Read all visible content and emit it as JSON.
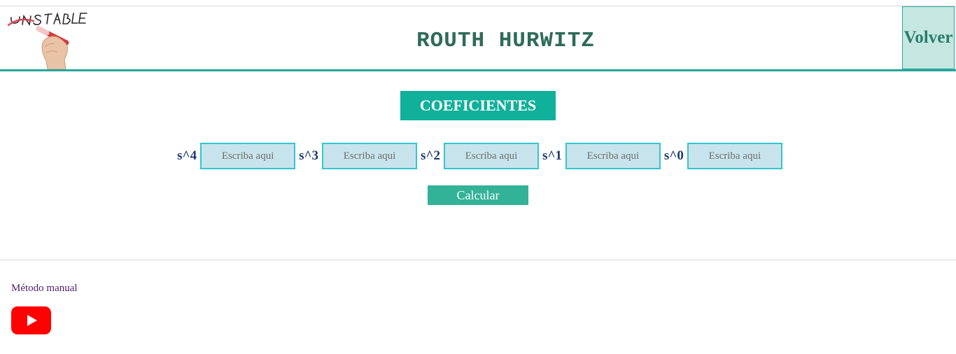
{
  "header": {
    "logo_text": "UNSTABLE",
    "title": "ROUTH HURWITZ",
    "back_label": "Volver"
  },
  "main": {
    "section_heading": "COEFICIENTES",
    "coefficients": [
      {
        "label": "s^4",
        "value": "",
        "placeholder": "Escriba aqui"
      },
      {
        "label": "s^3",
        "value": "",
        "placeholder": "Escriba aqui"
      },
      {
        "label": "s^2",
        "value": "",
        "placeholder": "Escriba aqui"
      },
      {
        "label": "s^1",
        "value": "",
        "placeholder": "Escriba aqui"
      },
      {
        "label": "s^0",
        "value": "",
        "placeholder": "Escriba aqui"
      }
    ],
    "calculate_label": "Calcular"
  },
  "footer": {
    "manual_link": "Método manual",
    "video_icon": "youtube-play-icon"
  },
  "colors": {
    "accent": "#26a69a",
    "heading_bg": "#10b09a",
    "button_bg": "#32b296",
    "input_bg": "#c7e4ec",
    "input_border": "#35c5cf",
    "back_bg": "#c6e7e1",
    "title": "#2f6b5a",
    "label": "#1c3a6e",
    "youtube": "#ff0000"
  }
}
